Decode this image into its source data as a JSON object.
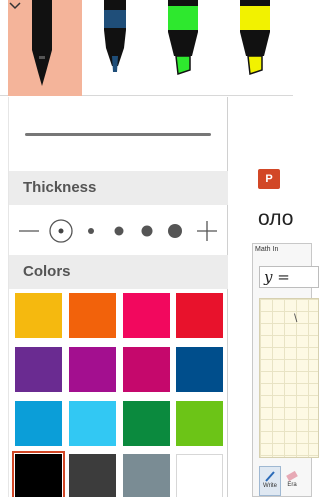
{
  "toolbar": {
    "pens": [
      {
        "name": "black-pen",
        "color": "#111111",
        "selected": true
      },
      {
        "name": "blue-pen",
        "color": "#1f4e79",
        "selected": false
      },
      {
        "name": "green-highlighter",
        "color": "#2ee82e",
        "selected": false
      },
      {
        "name": "yellow-highlighter",
        "color": "#f2f200",
        "selected": false
      }
    ]
  },
  "flyout": {
    "thickness_label": "Thickness",
    "colors_label": "Colors",
    "thickness_options": [
      "thinnest",
      "thin",
      "medium",
      "thick",
      "thickest"
    ],
    "selected_thickness": "thinnest",
    "colors": [
      [
        "#f5b90f",
        "#f2620b",
        "#f2085e",
        "#e8122c"
      ],
      [
        "#6a2b91",
        "#a30f8f",
        "#c5086c",
        "#004e8c"
      ],
      [
        "#0b9ed8",
        "#32c8f3",
        "#0b8a3e",
        "#6cc417"
      ],
      [
        "#000000",
        "#3c3c3c",
        "#7a8c94",
        "#ffffff"
      ]
    ],
    "selected_color": "#000000"
  },
  "background": {
    "app_icon_label": "P",
    "partial_text": "оло",
    "math_window_title": "Math In",
    "math_input": "y =",
    "tools": [
      "Write",
      "Era"
    ]
  }
}
